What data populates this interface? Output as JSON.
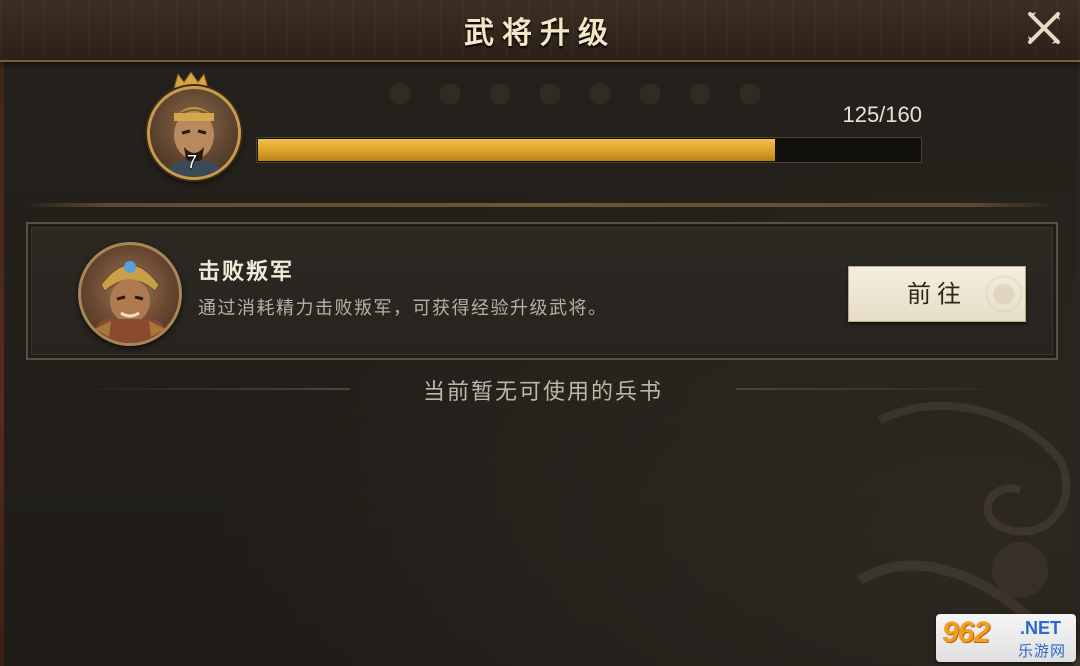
{
  "window": {
    "title": "武将升级",
    "close_icon": "close-x-icon"
  },
  "hero": {
    "level": "7",
    "exp_text": "125/160",
    "exp_current": 125,
    "exp_max": 160,
    "progress_fraction": 0.78125,
    "bar_color": "#dca02a"
  },
  "task": {
    "title": "击败叛军",
    "description": "通过消耗精力击败叛军，可获得经验升级武将。",
    "button_label": "前往"
  },
  "empty_state": {
    "text": "当前暂无可使用的兵书"
  },
  "watermark": {
    "logo": "962",
    "net": ".NET",
    "sub": "乐游网"
  }
}
